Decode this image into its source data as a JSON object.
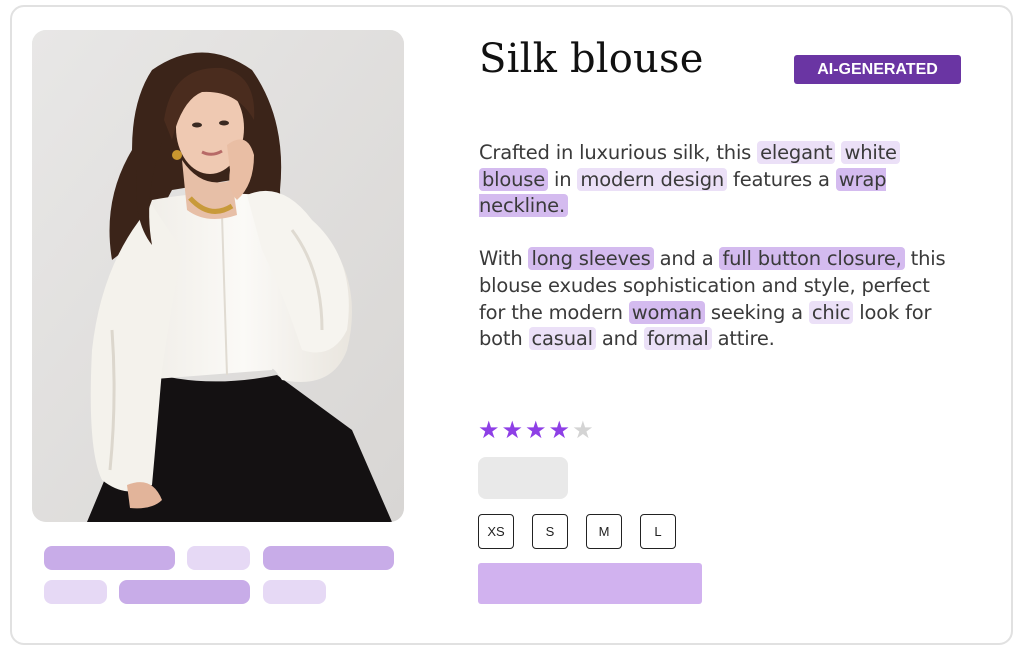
{
  "product": {
    "title": "Silk blouse",
    "badge": "AI-GENERATED",
    "image_alt": "Woman wearing a white silk blouse"
  },
  "description": {
    "paragraph1": [
      {
        "text": "Crafted in luxurious silk, this ",
        "hl": ""
      },
      {
        "text": "elegant",
        "hl": "light"
      },
      {
        "text": " ",
        "hl": ""
      },
      {
        "text": "white",
        "hl": "light"
      },
      {
        "text": " ",
        "hl": ""
      },
      {
        "text": "blouse",
        "hl": "dark"
      },
      {
        "text": " in ",
        "hl": ""
      },
      {
        "text": "modern design",
        "hl": "light"
      },
      {
        "text": " features a ",
        "hl": ""
      },
      {
        "text": "wrap neckline.",
        "hl": "dark"
      }
    ],
    "paragraph2": [
      {
        "text": "With ",
        "hl": ""
      },
      {
        "text": "long sleeves",
        "hl": "dark"
      },
      {
        "text": " and a ",
        "hl": ""
      },
      {
        "text": "full button closure,",
        "hl": "dark"
      },
      {
        "text": " this blouse exudes sophistication and style, perfect for the modern ",
        "hl": ""
      },
      {
        "text": "woman",
        "hl": "dark"
      },
      {
        "text": " seeking a ",
        "hl": ""
      },
      {
        "text": "chic",
        "hl": "light"
      },
      {
        "text": " look for both ",
        "hl": ""
      },
      {
        "text": "casual",
        "hl": "light"
      },
      {
        "text": " and ",
        "hl": ""
      },
      {
        "text": "formal",
        "hl": "light"
      },
      {
        "text": " attire.",
        "hl": ""
      }
    ]
  },
  "rating": {
    "value": 4,
    "max": 5
  },
  "sizes": [
    "XS",
    "S",
    "M",
    "L"
  ],
  "colors": {
    "accent": "#6a35a3",
    "star": "#8e3fe6",
    "highlight_dark": "#d4bbef",
    "highlight_light": "#ebe0f7",
    "button": "#d1b2ef"
  }
}
